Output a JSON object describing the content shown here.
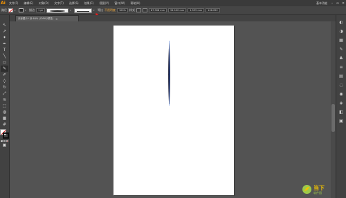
{
  "app": {
    "logo": "Ai",
    "accent": "#ff9a00"
  },
  "menu": {
    "items": [
      "文件(F)",
      "编辑(E)",
      "对象(O)",
      "文字(T)",
      "选择(S)",
      "效果(C)",
      "视图(V)",
      "窗口(W)",
      "帮助(H)"
    ],
    "workspace": "基本功能",
    "window_controls": [
      "minimize-icon",
      "restore-icon",
      "close-icon"
    ]
  },
  "controlbar": {
    "selection_label": "路径",
    "stroke_label": "描边",
    "stroke_weight": "1 pt",
    "uniform_label": "等比",
    "opacity_label": "不透明度",
    "opacity_value": "100%",
    "style_label": "样式",
    "x_value": "87.908 mm",
    "y_value": "94.100 mm",
    "w_value": "1.535 mm",
    "h_value": "106.052"
  },
  "document": {
    "tab_title": "未标题-1* @ 64% (CMYK/预览)",
    "close": "×"
  },
  "tools": [
    "selection-tool",
    "direct-selection-tool",
    "magic-wand-tool",
    "pen-tool",
    "type-tool",
    "line-tool",
    "rectangle-tool",
    "paintbrush-tool",
    "pencil-tool",
    "eraser-tool",
    "rotate-tool",
    "scale-tool",
    "width-tool",
    "free-transform-tool",
    "shape-builder-tool",
    "perspective-tool",
    "mesh-tool",
    "gradient-tool",
    "eyedropper-tool",
    "blend-tool",
    "symbol-sprayer-tool",
    "graph-tool",
    "artboard-tool",
    "slice-tool",
    "hand-tool",
    "zoom-tool"
  ],
  "tool_glyphs": [
    "↖",
    "↗",
    "✦",
    "✒",
    "T",
    "╲",
    "▭",
    "✎",
    "✐",
    "◊",
    "↻",
    "⤢",
    "≋",
    "⬚",
    "◍",
    "▦",
    "#",
    "▮",
    "✚",
    "◎",
    "☂",
    "▥",
    "▢",
    "✂",
    "✋",
    "⌕"
  ],
  "right_panel": [
    "color-panel-icon",
    "color-guide-icon",
    "swatches-icon",
    "brushes-icon",
    "symbols-icon",
    "stroke-icon",
    "gradient-icon",
    "transparency-icon",
    "appearance-icon",
    "graphic-styles-icon",
    "layers-icon",
    "artboards-icon"
  ],
  "right_glyphs": [
    "◐",
    "◑",
    "▦",
    "✎",
    "♣",
    "≡",
    "▤",
    "◌",
    "◉",
    "◈",
    "◧",
    "▣"
  ],
  "watermark": {
    "big": "当下",
    "small": "软件园"
  }
}
